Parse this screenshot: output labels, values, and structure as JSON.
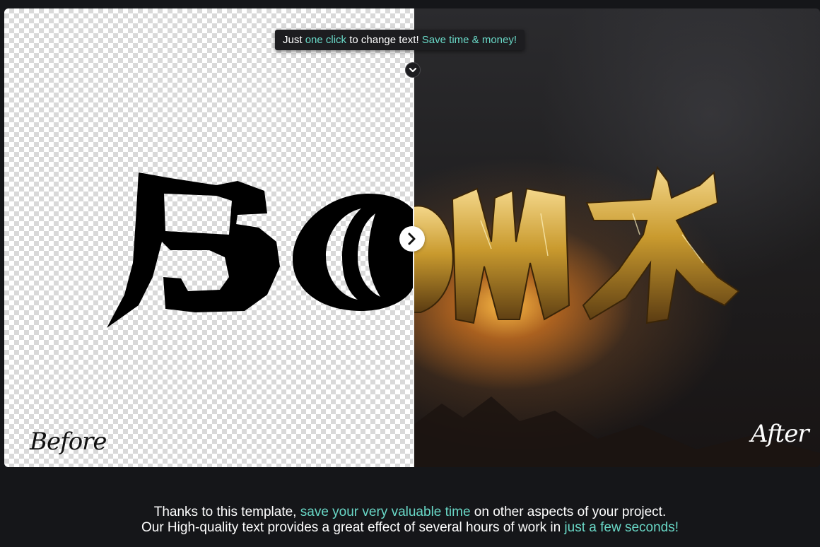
{
  "tooltip": {
    "part1": "Just ",
    "part2": "one click",
    "part3": " to change text! ",
    "part4": "Save time & money!"
  },
  "labels": {
    "before": "Before",
    "after": "After"
  },
  "bottom": {
    "line1_part1": "Thanks to this template, ",
    "line1_part2": "save your very valuable time",
    "line1_part3": " on other aspects of your project.",
    "line2_part1": "Our High-quality text provides a great effect of several hours of work in ",
    "line2_part2": "just a few seconds!"
  },
  "colors": {
    "accent": "#69d8c7",
    "background": "#151619",
    "gold": "#c99a2e"
  },
  "icons": {
    "tooltip_toggle": "chevron-down-icon",
    "slider_handle": "chevron-right-icon"
  },
  "slider": {
    "position_percent": 50
  }
}
